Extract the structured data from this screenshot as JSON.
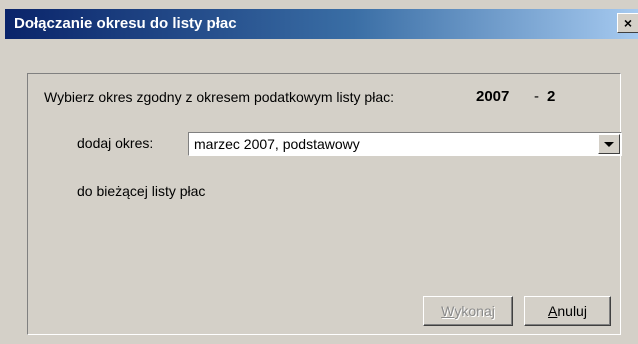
{
  "window": {
    "title": "Dołączanie okresu do listy płac",
    "close_glyph": "×",
    "close_icon": "close-icon"
  },
  "prompt": {
    "text": "Wybierz okres zgodny z okresem podatkowym listy płac:",
    "year": "2007",
    "separator": "-",
    "month": "2"
  },
  "period": {
    "label": "dodaj okres:",
    "selected": "marzec 2007, podstawowy",
    "dropdown_icon": "chevron-down-icon"
  },
  "target_text": "do bieżącej listy płac",
  "buttons": {
    "execute": {
      "mnemonic": "W",
      "rest": "ykonaj",
      "enabled": false
    },
    "cancel": {
      "mnemonic": "A",
      "rest": "nuluj",
      "enabled": true
    }
  },
  "colors": {
    "face": "#d4d0c8",
    "title_start": "#0a246a",
    "title_end": "#a6caf0",
    "disabled_text": "#8a8a8a"
  }
}
